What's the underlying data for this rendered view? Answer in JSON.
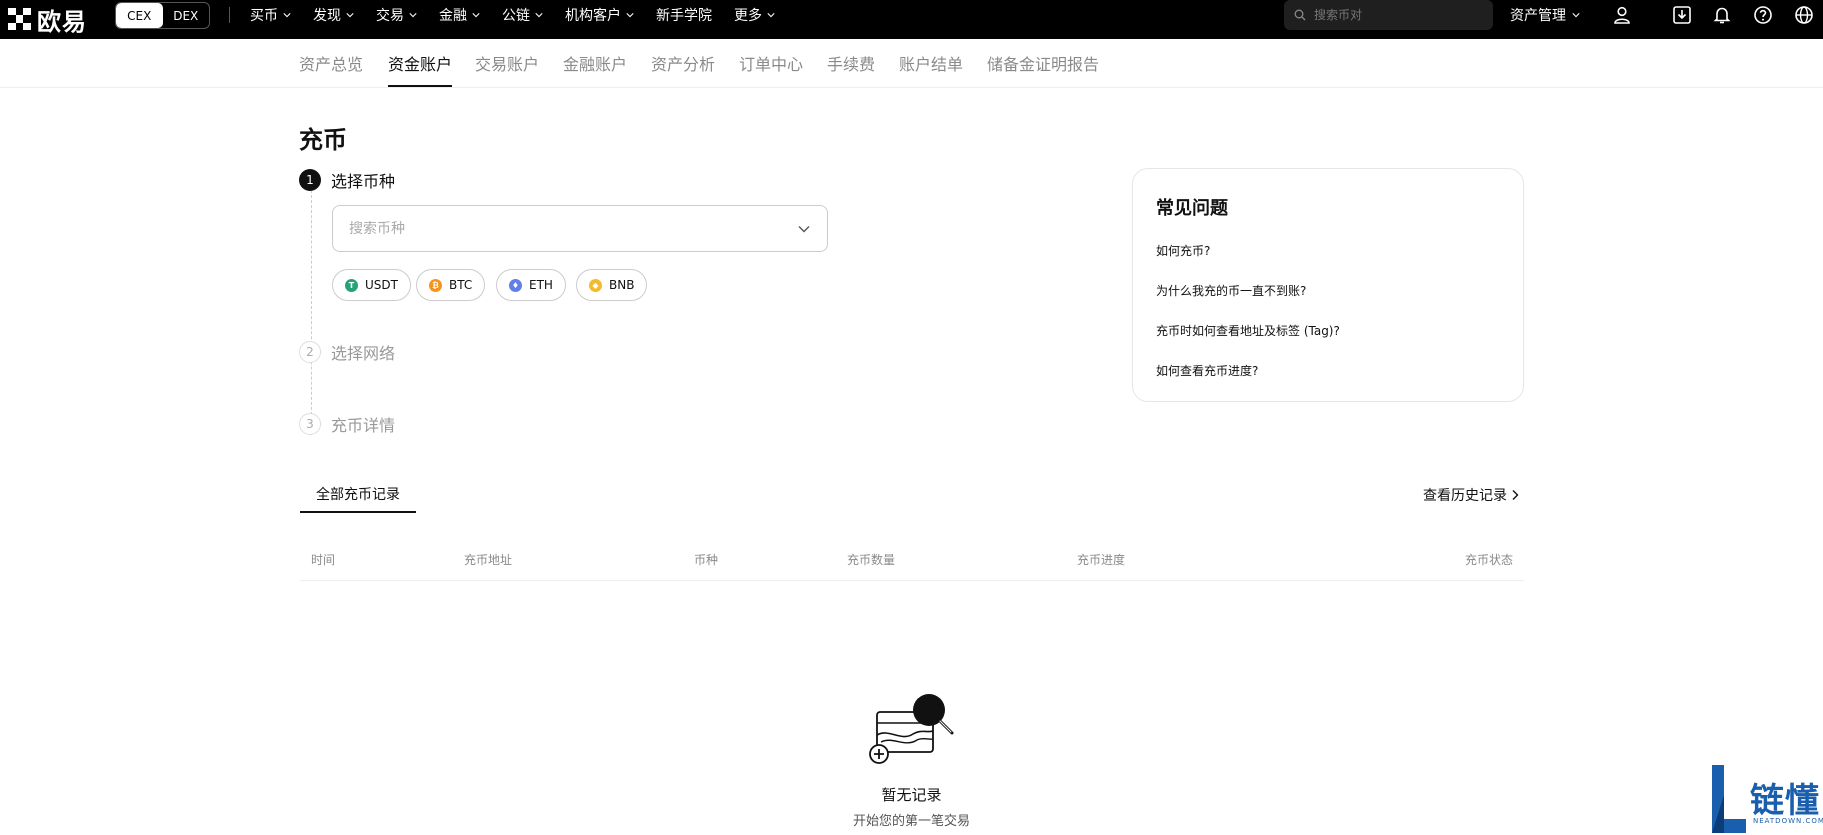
{
  "brand": {
    "name": "欧易"
  },
  "mode_switch": {
    "cex": "CEX",
    "dex": "DEX"
  },
  "top_nav": [
    "买币",
    "发现",
    "交易",
    "金融",
    "公链",
    "机构客户",
    "新手学院",
    "更多"
  ],
  "top_search": {
    "placeholder": "搜索币对"
  },
  "asset_mgmt": {
    "label": "资产管理"
  },
  "sub_nav": [
    "资产总览",
    "资金账户",
    "交易账户",
    "金融账户",
    "资产分析",
    "订单中心",
    "手续费",
    "账户结单",
    "储备金证明报告"
  ],
  "sub_nav_active": "资金账户",
  "page_title": "充币",
  "steps": [
    {
      "number": "1",
      "label": "选择币种"
    },
    {
      "number": "2",
      "label": "选择网络"
    },
    {
      "number": "3",
      "label": "充币详情"
    }
  ],
  "coin_select": {
    "placeholder": "搜索币种",
    "value": ""
  },
  "quick_coins": [
    {
      "symbol": "USDT",
      "color": "#26a17b",
      "glyph": "T"
    },
    {
      "symbol": "BTC",
      "color": "#f7931a",
      "glyph": "₿"
    },
    {
      "symbol": "ETH",
      "color": "#627eea",
      "glyph": "♦"
    },
    {
      "symbol": "BNB",
      "color": "#f3ba2f",
      "glyph": "◆"
    }
  ],
  "faq": {
    "title": "常见问题",
    "items": [
      "如何充币?",
      "为什么我充的币一直不到账?",
      "充币时如何查看地址及标签 (Tag)?",
      "如何查看充币进度?"
    ]
  },
  "records": {
    "tab": "全部充币记录",
    "history_link": "查看历史记录",
    "columns": [
      "时间",
      "充币地址",
      "币种",
      "充币数量",
      "充币进度",
      "充币状态"
    ],
    "rows": [],
    "empty_title": "暂无记录",
    "empty_subtitle": "开始您的第一笔交易"
  },
  "watermark": {
    "text": "链懂",
    "subtext": "NEATDOWN.COM"
  }
}
